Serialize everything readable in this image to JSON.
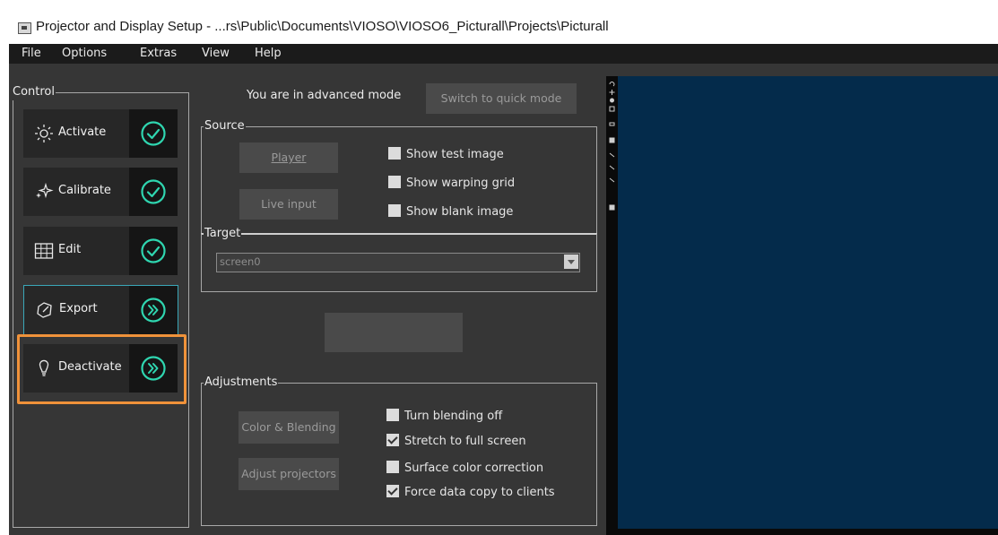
{
  "window": {
    "title": "Projector and Display Setup - ...rs\\Public\\Documents\\VIOSO\\VIOSO6_Picturall\\Projects\\Picturall"
  },
  "menu": {
    "items": [
      "File",
      "Options",
      "Extras",
      "View",
      "Help"
    ]
  },
  "control": {
    "legend": "Control",
    "buttons": [
      {
        "label": "Activate",
        "icon": "sun-icon",
        "state": "check-circle-icon",
        "selected": false,
        "highlighted": false
      },
      {
        "label": "Calibrate",
        "icon": "sparkle-icon",
        "state": "check-circle-icon",
        "selected": false,
        "highlighted": false
      },
      {
        "label": "Edit",
        "icon": "grid-edit-icon",
        "state": "check-circle-icon",
        "selected": false,
        "highlighted": false
      },
      {
        "label": "Export",
        "icon": "export-icon",
        "state": "double-chevron-circle-icon",
        "selected": true,
        "highlighted": false
      },
      {
        "label": "Deactivate",
        "icon": "bulb-icon",
        "state": "double-chevron-circle-icon",
        "selected": false,
        "highlighted": true
      }
    ]
  },
  "mode": {
    "text": "You are in advanced mode",
    "switch_label": "Switch to quick mode"
  },
  "source": {
    "legend": "Source",
    "player_label": "Player",
    "live_input_label": "Live input",
    "checkboxes": [
      {
        "label": "Show test image",
        "checked": false
      },
      {
        "label": "Show warping grid",
        "checked": false
      },
      {
        "label": "Show blank image",
        "checked": false
      }
    ]
  },
  "target": {
    "legend": "Target",
    "value": "screen0"
  },
  "adjustments": {
    "legend": "Adjustments",
    "color_blending_label": "Color & Blending",
    "adjust_projectors_label": "Adjust projectors",
    "checkboxes": [
      {
        "label": "Turn blending off",
        "checked": false
      },
      {
        "label": "Stretch to full screen",
        "checked": true
      },
      {
        "label": "Surface color correction",
        "checked": false
      },
      {
        "label": "Force data copy to clients",
        "checked": true
      }
    ]
  },
  "colors": {
    "accent_teal": "#2fd6b0",
    "highlight_orange": "#f0923a",
    "selected_border": "#3aa7b8",
    "viewport_blue": "#042b4b"
  }
}
